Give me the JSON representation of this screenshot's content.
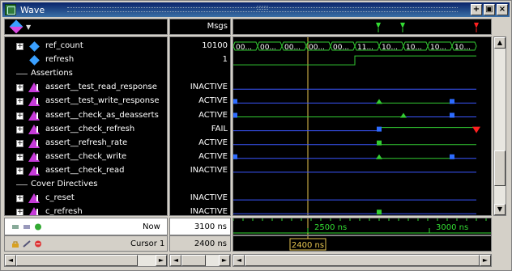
{
  "window": {
    "title": "Wave"
  },
  "header": {
    "values_label": "Msgs"
  },
  "signals": [
    {
      "kind": "signal",
      "icon": "diamond",
      "expandable": true,
      "name": "ref_count",
      "value": "10100"
    },
    {
      "kind": "signal",
      "icon": "diamond",
      "expandable": false,
      "name": "refresh",
      "value": "1"
    },
    {
      "kind": "section",
      "name": "Assertions"
    },
    {
      "kind": "signal",
      "icon": "triangle",
      "expandable": true,
      "name": "assert__test_read_response",
      "value": "INACTIVE"
    },
    {
      "kind": "signal",
      "icon": "triangle",
      "expandable": true,
      "name": "assert__test_write_response",
      "value": "ACTIVE"
    },
    {
      "kind": "signal",
      "icon": "triangle",
      "expandable": true,
      "name": "assert__check_as_deasserts",
      "value": "ACTIVE"
    },
    {
      "kind": "signal",
      "icon": "triangle",
      "expandable": true,
      "name": "assert__check_refresh",
      "value": "FAIL"
    },
    {
      "kind": "signal",
      "icon": "triangle",
      "expandable": true,
      "name": "assert__refresh_rate",
      "value": "ACTIVE"
    },
    {
      "kind": "signal",
      "icon": "triangle",
      "expandable": true,
      "name": "assert__check_write",
      "value": "ACTIVE"
    },
    {
      "kind": "signal",
      "icon": "triangle",
      "expandable": true,
      "name": "assert__check_read",
      "value": "INACTIVE"
    },
    {
      "kind": "section",
      "name": "Cover Directives"
    },
    {
      "kind": "signal",
      "icon": "triangle",
      "expandable": true,
      "name": "c_reset",
      "value": "INACTIVE"
    },
    {
      "kind": "signal",
      "icon": "triangle",
      "expandable": true,
      "name": "c_refresh",
      "value": "INACTIVE"
    }
  ],
  "bus_segments": [
    "00...",
    "00...",
    "00...",
    "00...",
    "00...",
    "11...",
    "10...",
    "10...",
    "10...",
    "10..."
  ],
  "timeline": {
    "now_label": "Now",
    "now_value": "3100 ns",
    "cursor_label": "Cursor 1",
    "cursor_value": "2400 ns",
    "cursor_badge": "2400 ns",
    "ticks": [
      "2500 ns",
      "3000 ns"
    ]
  },
  "colors": {
    "wave_green": "#33cc33",
    "wave_blue": "#3b57ff",
    "marker_blue": "#2d6bff",
    "fail_red": "#ff2020",
    "cursor_yellow": "#e7c650",
    "bg": "#000000"
  }
}
